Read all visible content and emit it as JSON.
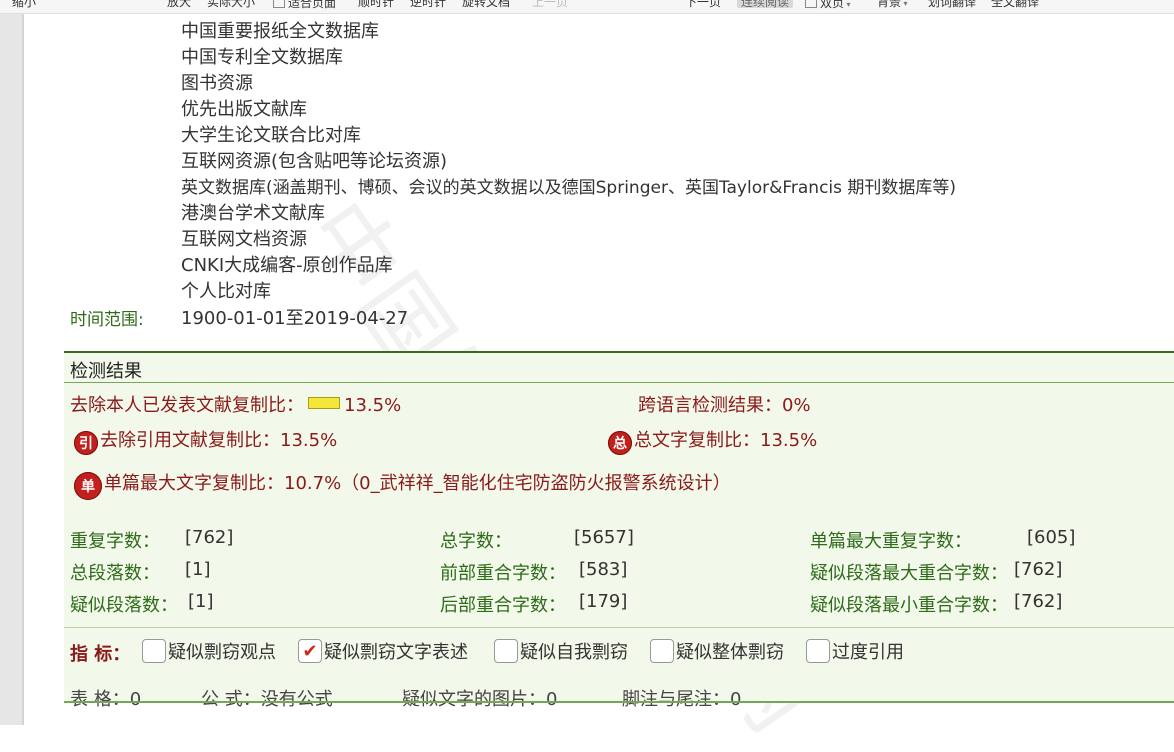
{
  "toolbar": {
    "zoom_out": "缩小",
    "zoom_in": "放大",
    "actual_size": "实际大小",
    "fit_page": "适合页面",
    "rotate_cw": "顺时针",
    "rotate_ccw": "逆时针",
    "rotate_doc": "旋转文档",
    "prev_page": "上一页",
    "next_page": "下一页",
    "continuous": "连续阅读",
    "double_page": "双页",
    "background": "背景",
    "word_translate": "划词翻译",
    "full_translate": "全文翻译"
  },
  "databases": [
    "中国重要报纸全文数据库",
    "中国专利全文数据库",
    "图书资源",
    "优先出版文献库",
    "大学生论文联合比对库",
    "互联网资源(包含贴吧等论坛资源)",
    "英文数据库(涵盖期刊、博硕、会议的英文数据以及德国Springer、英国Taylor&Francis 期刊数据库等)",
    "港澳台学术文献库",
    "互联网文档资源",
    "CNKI大成编客-原创作品库",
    "个人比对库"
  ],
  "time_range": {
    "label": "时间范围:",
    "value": "1900-01-01至2019-04-27"
  },
  "results": {
    "title": "检测结果",
    "excl_self_label": "去除本人已发表文献复制比：",
    "excl_self_value": "13.5%",
    "cross_lang_label": "跨语言检测结果：",
    "cross_lang_value": "0%",
    "excl_cite_badge": "引",
    "excl_cite_label": "去除引用文献复制比：",
    "excl_cite_value": "13.5%",
    "total_badge": "总",
    "total_label": "总文字复制比：",
    "total_value": "13.5%",
    "single_badge": "单",
    "single_label": "单篇最大文字复制比：",
    "single_value": "10.7%（0_武祥祥_智能化住宅防盗防火报警系统设计）",
    "progress_fraction": 0.135,
    "stats": [
      {
        "label": "重复字数：",
        "value": "[762]"
      },
      {
        "label": "总字数：",
        "value": "[5657]"
      },
      {
        "label": "单篇最大重复字数：",
        "value": "[605]"
      },
      {
        "label": "总段落数：",
        "value": "[1]"
      },
      {
        "label": "前部重合字数：",
        "value": "[583]"
      },
      {
        "label": "疑似段落最大重合字数：",
        "value": "[762]"
      },
      {
        "label": "疑似段落数：",
        "value": "[1]"
      },
      {
        "label": "后部重合字数：",
        "value": "[179]"
      },
      {
        "label": "疑似段落最小重合字数：",
        "value": "[762]"
      }
    ],
    "indicator_label": "指  标：",
    "indicators": [
      {
        "label": "疑似剽窃观点",
        "checked": false
      },
      {
        "label": "疑似剽窃文字表述",
        "checked": true
      },
      {
        "label": "疑似自我剽窃",
        "checked": false
      },
      {
        "label": "疑似整体剽窃",
        "checked": false
      },
      {
        "label": "过度引用",
        "checked": false
      }
    ],
    "info": {
      "tables": "表  格：0",
      "formulas": "公  式：没有公式",
      "images": "疑似文字的图片：0",
      "footnotes": "脚注与尾注：0"
    }
  },
  "colors": {
    "label_green": "#2f6b1a",
    "accent_red": "#8b1a1a",
    "panel_bg": "#f2f8ea"
  }
}
